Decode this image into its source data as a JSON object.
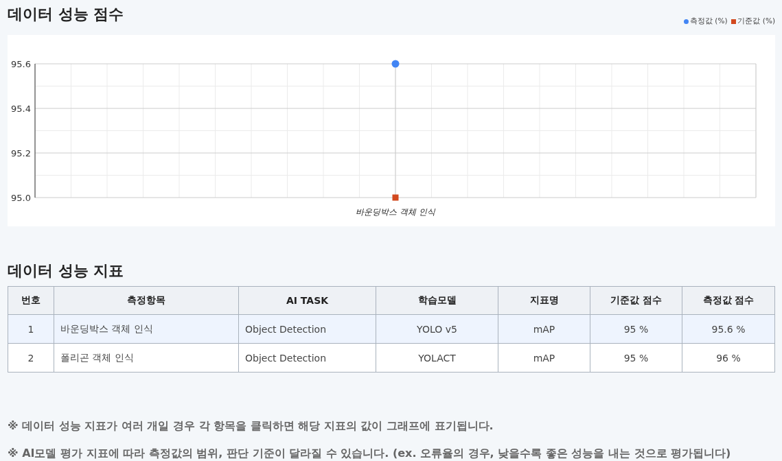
{
  "score_section": {
    "title": "데이터 성능 점수",
    "chart_data": {
      "type": "line",
      "categories": [
        "바운딩박스 객체 인식"
      ],
      "ylim": [
        95.0,
        95.6
      ],
      "grid": true,
      "yticks": [
        {
          "value": 95.0,
          "label": "95.0"
        },
        {
          "value": 95.2,
          "label": "95.2"
        },
        {
          "value": 95.4,
          "label": "95.4"
        },
        {
          "value": 95.6,
          "label": "95.6"
        }
      ],
      "series": [
        {
          "name": "측정값 (%)",
          "color": "#4285f4",
          "marker": "circle",
          "values": [
            95.6
          ]
        },
        {
          "name": "기준값 (%)",
          "color": "#d2491f",
          "marker": "square",
          "values": [
            95.0
          ]
        }
      ]
    }
  },
  "metrics_section": {
    "title": "데이터 성능 지표",
    "table": {
      "columns": [
        "번호",
        "측정항목",
        "AI TASK",
        "학습모델",
        "지표명",
        "기준값 점수",
        "측정값 점수"
      ],
      "rows": [
        {
          "selected": true,
          "cells": [
            "1",
            "바운딩박스 객체 인식",
            "Object Detection",
            "YOLO v5",
            "mAP",
            "95 %",
            "95.6 %"
          ]
        },
        {
          "selected": false,
          "cells": [
            "2",
            "폴리곤 객체 인식",
            "Object Detection",
            "YOLACT",
            "mAP",
            "95 %",
            "96 %"
          ]
        }
      ]
    }
  },
  "notes": [
    "※ 데이터 성능 지표가 여러 개일 경우 각 항목을 클릭하면 해당 지표의 값이 그래프에 표기됩니다.",
    "※ AI모델 평가 지표에 따라 측정값의 범위, 판단 기준이 달라질 수 있습니다. (ex. 오류율의 경우, 낮을수록 좋은 성능을 내는 것으로 평가됩니다)"
  ]
}
